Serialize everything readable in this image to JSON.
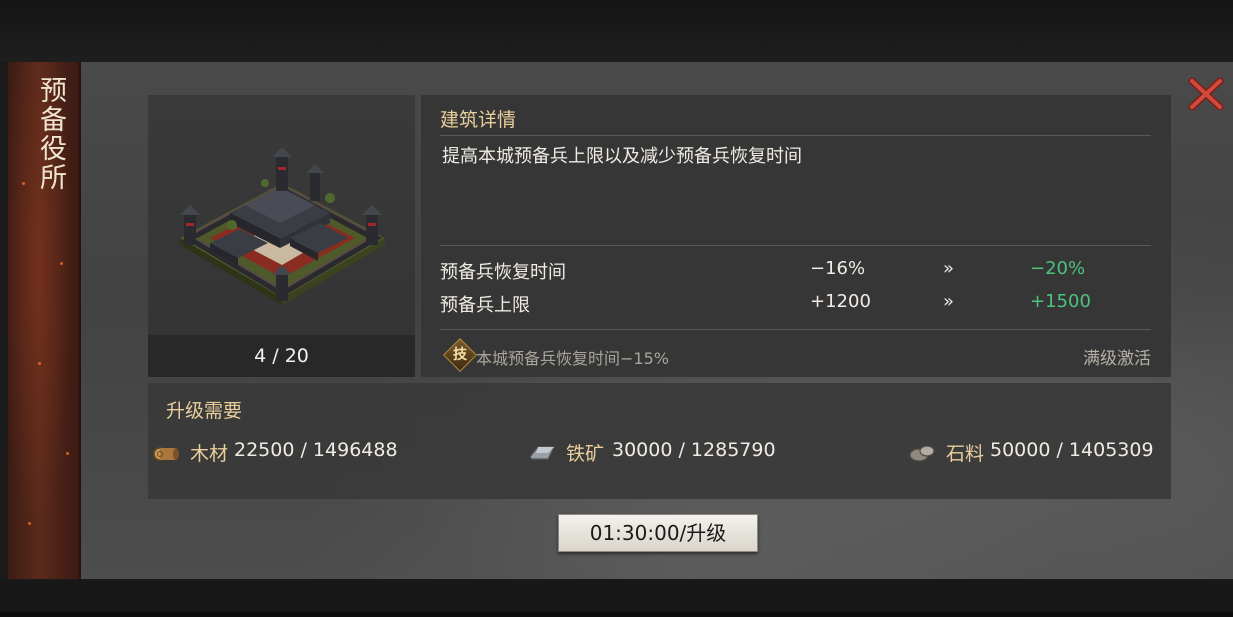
{
  "building": {
    "name": "预备役所",
    "level": "4 / 20"
  },
  "details": {
    "heading": "建筑详情",
    "description": "提高本城预备兵上限以及减少预备兵恢复时间",
    "stats": [
      {
        "label": "预备兵恢复时间",
        "current": "−16%",
        "arrow": "»",
        "next": "−20%"
      },
      {
        "label": "预备兵上限",
        "current": "+1200",
        "arrow": "»",
        "next": "+1500"
      }
    ],
    "skill": {
      "icon_char": "技",
      "text": "本城预备兵恢复时间−15%",
      "status": "满级激活"
    }
  },
  "requirements": {
    "heading": "升级需要",
    "resources": [
      {
        "icon": "wood-icon",
        "name": "木材",
        "amount": "22500 / 1496488"
      },
      {
        "icon": "iron-ore-icon",
        "name": "铁矿",
        "amount": "30000 / 1285790"
      },
      {
        "icon": "stone-icon",
        "name": "石料",
        "amount": "50000 / 1405309"
      }
    ]
  },
  "upgrade": {
    "label": "01:30:00/升级"
  },
  "colors": {
    "heading_gold": "#e9cf9c",
    "positive_green": "#4fc27c",
    "close_red": "#c8463a",
    "banner_red": "#5b2a1c"
  }
}
